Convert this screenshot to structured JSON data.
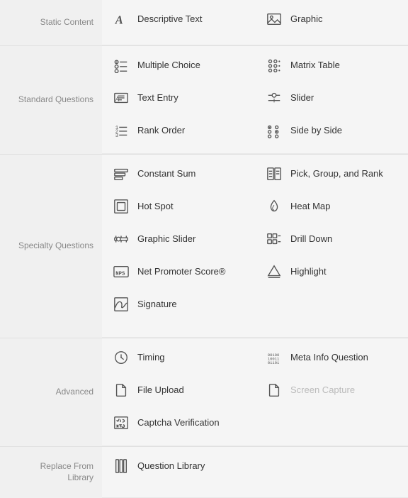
{
  "sections": [
    {
      "id": "static",
      "label": "Static Content",
      "items": [
        {
          "id": "descriptive-text",
          "label": "Descriptive Text",
          "icon": "text-a",
          "disabled": false
        },
        {
          "id": "graphic",
          "label": "Graphic",
          "icon": "image",
          "disabled": false
        }
      ]
    },
    {
      "id": "standard",
      "label": "Standard Questions",
      "items": [
        {
          "id": "multiple-choice",
          "label": "Multiple Choice",
          "icon": "radio-list",
          "disabled": false
        },
        {
          "id": "matrix-table",
          "label": "Matrix Table",
          "icon": "matrix",
          "disabled": false
        },
        {
          "id": "text-entry",
          "label": "Text Entry",
          "icon": "text-entry",
          "disabled": false
        },
        {
          "id": "slider",
          "label": "Slider",
          "icon": "slider",
          "disabled": false
        },
        {
          "id": "rank-order",
          "label": "Rank Order",
          "icon": "rank",
          "disabled": false
        },
        {
          "id": "side-by-side",
          "label": "Side by Side",
          "icon": "side-by-side",
          "disabled": false
        }
      ]
    },
    {
      "id": "specialty",
      "label": "Specialty Questions",
      "items": [
        {
          "id": "constant-sum",
          "label": "Constant Sum",
          "icon": "constant-sum",
          "disabled": false
        },
        {
          "id": "pick-group-rank",
          "label": "Pick, Group, and Rank",
          "icon": "pick-group",
          "disabled": false
        },
        {
          "id": "hot-spot",
          "label": "Hot Spot",
          "icon": "hot-spot",
          "disabled": false
        },
        {
          "id": "heat-map",
          "label": "Heat Map",
          "icon": "heat-map",
          "disabled": false
        },
        {
          "id": "graphic-slider",
          "label": "Graphic Slider",
          "icon": "graphic-slider",
          "disabled": false
        },
        {
          "id": "drill-down",
          "label": "Drill Down",
          "icon": "drill-down",
          "disabled": false
        },
        {
          "id": "net-promoter",
          "label": "Net Promoter Score®",
          "icon": "nps",
          "disabled": false
        },
        {
          "id": "highlight",
          "label": "Highlight",
          "icon": "highlight",
          "disabled": false
        },
        {
          "id": "signature",
          "label": "Signature",
          "icon": "signature",
          "disabled": false
        }
      ]
    },
    {
      "id": "advanced",
      "label": "Advanced",
      "items": [
        {
          "id": "timing",
          "label": "Timing",
          "icon": "timing",
          "disabled": false
        },
        {
          "id": "meta-info",
          "label": "Meta Info Question",
          "icon": "meta-info",
          "disabled": false
        },
        {
          "id": "file-upload",
          "label": "File Upload",
          "icon": "file-upload",
          "disabled": false
        },
        {
          "id": "screen-capture",
          "label": "Screen Capture",
          "icon": "screen-capture",
          "disabled": true
        },
        {
          "id": "captcha",
          "label": "Captcha Verification",
          "icon": "captcha",
          "disabled": false
        }
      ]
    },
    {
      "id": "replace",
      "label": "Replace From\nLibrary",
      "items": [
        {
          "id": "question-library",
          "label": "Question Library",
          "icon": "question-library",
          "disabled": false
        }
      ]
    }
  ]
}
